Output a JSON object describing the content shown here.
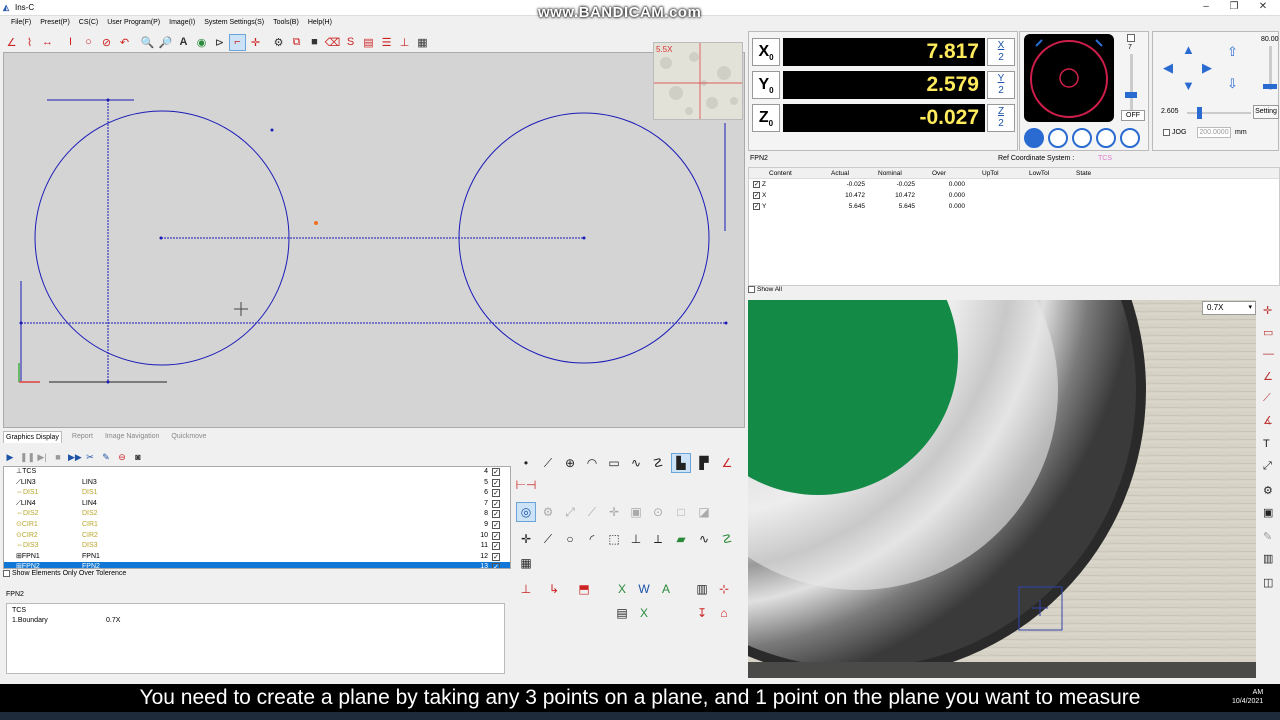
{
  "window": {
    "title": "Ins-C",
    "watermark": "www.BANDICAM.com"
  },
  "menu": [
    "File(F)",
    "Preset(P)",
    "CS(C)",
    "User Program(P)",
    "Image(I)",
    "System Settings(S)",
    "Tools(B)",
    "Help(H)"
  ],
  "thumbnail": {
    "zoom": "5.5X"
  },
  "tabs": [
    "Graphics Display",
    "Report",
    "Image Navigation",
    "Quickmove"
  ],
  "features": [
    {
      "icon": "⊥",
      "name": "TCS",
      "ref": "",
      "num": "4",
      "checked": true,
      "style": ""
    },
    {
      "icon": "⟋",
      "name": "LIN3",
      "ref": "LIN3",
      "num": "5",
      "checked": true,
      "style": ""
    },
    {
      "icon": "⇔",
      "name": "DIS1",
      "ref": "DIS1",
      "num": "6",
      "checked": true,
      "style": "yl"
    },
    {
      "icon": "⟋",
      "name": "LIN4",
      "ref": "LIN4",
      "num": "7",
      "checked": true,
      "style": ""
    },
    {
      "icon": "⇔",
      "name": "DIS2",
      "ref": "DIS2",
      "num": "8",
      "checked": true,
      "style": "yl"
    },
    {
      "icon": "⊙",
      "name": "CIR1",
      "ref": "CIR1",
      "num": "9",
      "checked": true,
      "style": "yl"
    },
    {
      "icon": "⊙",
      "name": "CIR2",
      "ref": "CIR2",
      "num": "10",
      "checked": true,
      "style": "yl"
    },
    {
      "icon": "⇔",
      "name": "DIS3",
      "ref": "DIS3",
      "num": "11",
      "checked": true,
      "style": "yl"
    },
    {
      "icon": "⊞",
      "name": "FPN1",
      "ref": "FPN1",
      "num": "12",
      "checked": true,
      "style": ""
    },
    {
      "icon": "⊞",
      "name": "FPN2",
      "ref": "FPN2",
      "num": "13",
      "checked": true,
      "style": "selrow"
    }
  ],
  "tolerance_filter": "Show Elements Only Over Tolerence",
  "detail": {
    "title": "FPN2",
    "cs": "TCS",
    "row_label": "1.Boundary",
    "row_value": "0.7X"
  },
  "dro": {
    "x": {
      "label": "X",
      "value": "7.817"
    },
    "y": {
      "label": "Y",
      "value": "2.579"
    },
    "z": {
      "label": "Z",
      "value": "-0.027"
    },
    "half": "2",
    "light_level": "7",
    "light_off": "OFF"
  },
  "motion": {
    "speed": "80.00",
    "step": "2.605",
    "jog": "JOG",
    "jog_value": "200.0000",
    "unit": "mm",
    "setting": "Setting"
  },
  "feature_table": {
    "name": "FPN2",
    "ref_cs_label": "Ref Coordinate System :",
    "ref_cs": "TCS",
    "headers": [
      "Content",
      "Actual",
      "Nominal",
      "Over",
      "UpTol",
      "LowTol",
      "State"
    ],
    "rows": [
      {
        "content": "Z",
        "actual": "-0.025",
        "nominal": "-0.025",
        "over": "0.000"
      },
      {
        "content": "X",
        "actual": "10.472",
        "nominal": "10.472",
        "over": "0.000"
      },
      {
        "content": "Y",
        "actual": "5.645",
        "nominal": "5.645",
        "over": "0.000"
      }
    ],
    "show_all": "Show All"
  },
  "camera": {
    "zoom": "0.7X"
  },
  "subtitle": "You need to create a plane by taking any 3 points on a plane, and 1 point on the plane you want to measure",
  "clock": {
    "time": "AM",
    "date": "10/4/2021"
  },
  "colors": {
    "drawing": "#1a1ab8",
    "dro_value": "#ffeb5c",
    "accent": "#2a6bd1"
  }
}
